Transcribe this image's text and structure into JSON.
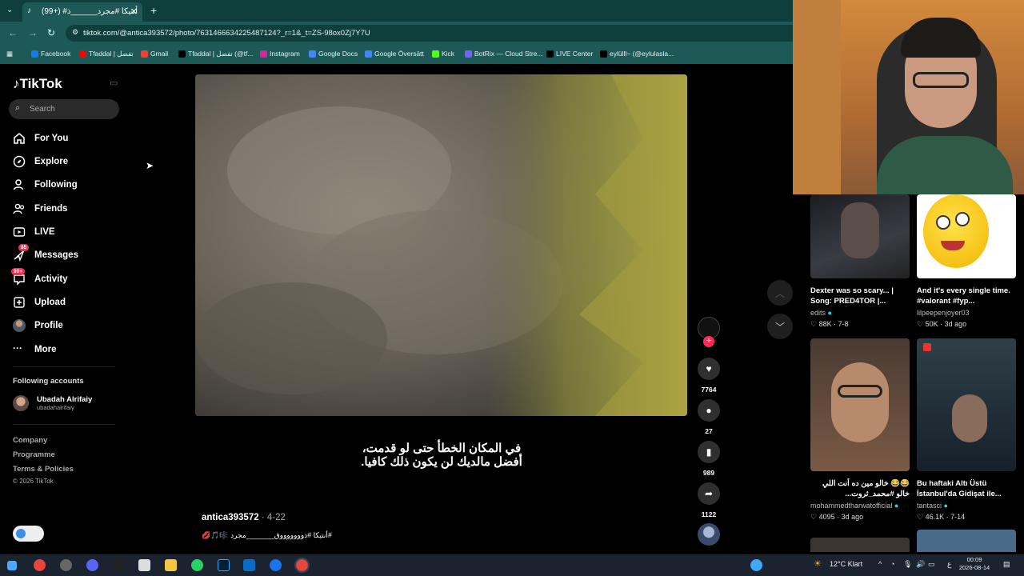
{
  "browser": {
    "tab_title": "(99+) #أنتيكا #مجرد______ذ",
    "url": "tiktok.com/@antica393572/photo/7631466634225487124?_r=1&_t=ZS-98ox0Zj7Y7U",
    "bookmarks": [
      "Facebook",
      "Tfaddal | تفضل",
      "Gmail",
      "Tfaddal | تفضل (@tf...",
      "Instagram",
      "Google Docs",
      "Google Översätt",
      "Kick",
      "BotRix — Cloud Stre...",
      "LIVE Center",
      "eylülll~ (@eylulasla..."
    ]
  },
  "sidebar": {
    "logo": "TikTok",
    "search_placeholder": "Search",
    "items": [
      {
        "label": "For You",
        "icon": "home-icon"
      },
      {
        "label": "Explore",
        "icon": "compass-icon"
      },
      {
        "label": "Following",
        "icon": "user-follow-icon"
      },
      {
        "label": "Friends",
        "icon": "friends-icon"
      },
      {
        "label": "LIVE",
        "icon": "live-icon"
      },
      {
        "label": "Messages",
        "icon": "message-icon",
        "badge": "85"
      },
      {
        "label": "Activity",
        "icon": "inbox-icon",
        "badge": "99+"
      },
      {
        "label": "Upload",
        "icon": "upload-icon"
      },
      {
        "label": "Profile",
        "icon": "avatar-icon"
      },
      {
        "label": "More",
        "icon": "more-icon"
      }
    ],
    "following_heading": "Following accounts",
    "following": [
      {
        "name": "Ubadah Alrifaiy",
        "handle": "ubadahalrifaiy"
      }
    ],
    "footer": [
      "Company",
      "Programme",
      "Terms & Policies",
      "© 2026 TikTok"
    ]
  },
  "post": {
    "subtitle_line1": "في المكان الخطأ حتى لو قدمت،",
    "subtitle_line2": "أفضل مالديك لن يكون ذلك كافيا.",
    "author": "antica393572",
    "date": " · 4-22",
    "caption": "#أنتيكا #ذوووووووق_______مجرد 🎼🎵💋",
    "counts": {
      "likes": "7764",
      "comments": "27",
      "saves": "989",
      "shares": "1122"
    }
  },
  "recommendations": [
    {
      "title": "Dexter was so scary... | Song: PRED4TOR |...",
      "user": "edits",
      "verified": true,
      "views": "88K",
      "date": "7-8"
    },
    {
      "title": "And it's every single time. #valorant #fyp...",
      "user": "lilpeepenjoyer03",
      "verified": false,
      "views": "50K",
      "date": "3d ago"
    },
    {
      "title": "😂😂 خالو مين ده أنت اللي خالو #محمد_ثروت...",
      "user": "mohammedtharwatofficial",
      "verified": true,
      "views": "4095",
      "date": "3d ago"
    },
    {
      "title": "Bu haftaki Altı Üstü İstanbul'da Gidişat ile...",
      "user": "tantasci",
      "verified": true,
      "views": "46.1K",
      "date": "7-14"
    }
  ],
  "taskbar": {
    "weather": "12°C  Klart",
    "time": "00:09",
    "date": "2026-08-14",
    "lang": "ع"
  },
  "colors": {
    "tiktok_red": "#fe2c55",
    "browser_teal": "#1d5a57",
    "verified": "#20d5ec"
  }
}
